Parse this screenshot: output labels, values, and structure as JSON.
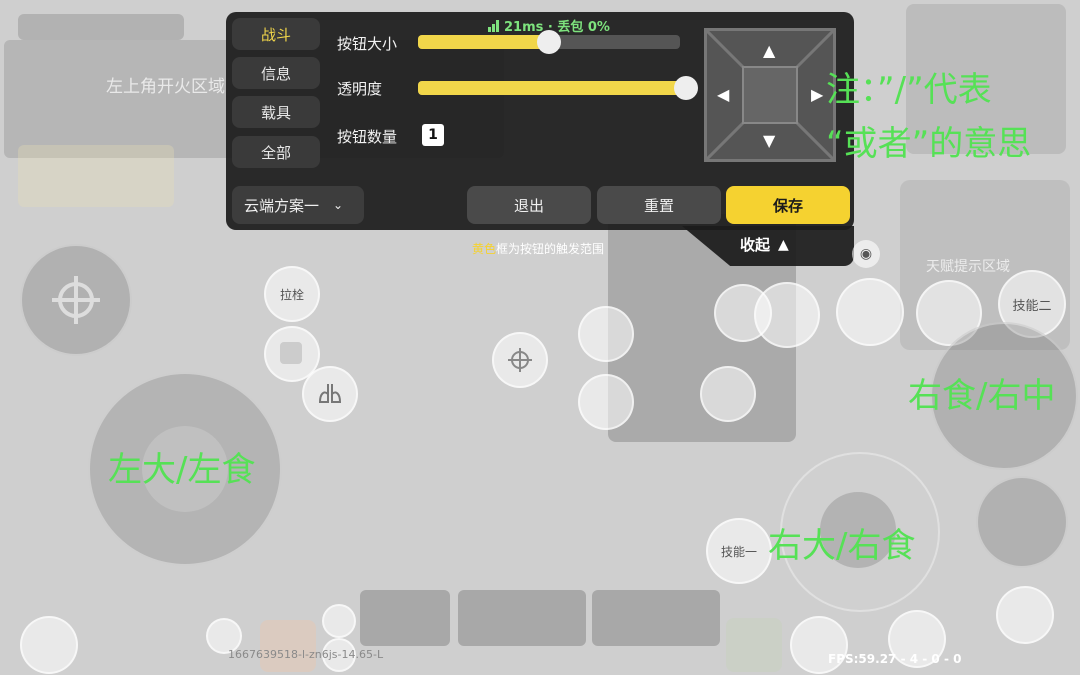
{
  "top_status": {
    "network": "21ms · 丢包 0%"
  },
  "background": {
    "fire_zone_label": "左上角开火区域",
    "skill_zone_label": "天赋提示区域",
    "pull_label": "拉栓",
    "skill_two_label": "技能二",
    "skill_one_label": "技能一",
    "device_id": "1667639518-l-zn6js-14.65-L",
    "fps": "FPS:59.27 - 4 - 0 - 0"
  },
  "settings_panel": {
    "tabs": [
      {
        "label": "战斗",
        "active": true
      },
      {
        "label": "信息",
        "active": false
      },
      {
        "label": "载具",
        "active": false
      },
      {
        "label": "全部",
        "active": false
      }
    ],
    "button_size_label": "按钮大小",
    "button_size_value": 0.5,
    "opacity_label": "透明度",
    "opacity_value": 1.0,
    "button_count_label": "按钮数量",
    "button_count_value": "1",
    "scheme_select": "云端方案一",
    "exit_label": "退出",
    "reset_label": "重置",
    "save_label": "保存",
    "collapse_label": "收起",
    "hint_highlight": "黄色",
    "hint_rest": "框为按钮的触发范围"
  },
  "annotations": {
    "note_line1": "注：”/”代表",
    "note_line2": "“或者”的意思",
    "right_top": "右食/右中",
    "left_joystick": "左大/左食",
    "right_joystick": "右大/右食"
  },
  "colors": {
    "accent": "#f5d230",
    "annotation": "#56e156",
    "panel": "#1f1f1f"
  }
}
